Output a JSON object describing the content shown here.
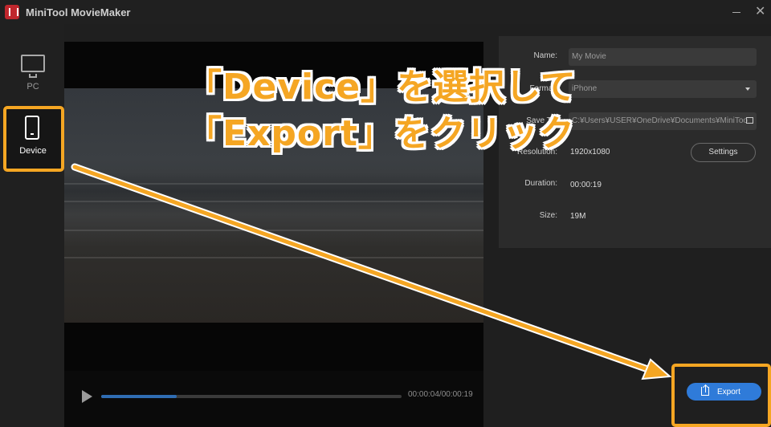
{
  "app": {
    "title": "MiniTool MovieMaker"
  },
  "sidebar": {
    "items": [
      {
        "label": "PC",
        "icon": "monitor-icon"
      },
      {
        "label": "Device",
        "icon": "phone-icon",
        "selected": true
      }
    ]
  },
  "player": {
    "time": "00:00:04/00:00:19",
    "progress": 0.25
  },
  "settings": {
    "name_label": "Name:",
    "name_value": "My Movie",
    "format_label": "Format:",
    "format_value": "iPhone",
    "save_label": "Save To:",
    "save_value": "C:¥Users¥USER¥OneDrive¥Documents¥MiniToo",
    "resolution_label": "Resolution:",
    "resolution_value": "1920x1080",
    "settings_button": "Settings",
    "duration_label": "Duration:",
    "duration_value": "00:00:19",
    "size_label": "Size:",
    "size_value": "19M"
  },
  "export": {
    "label": "Export"
  },
  "annotation": {
    "line1": "「Device」を選択して",
    "line2": "「Export」をクリック"
  },
  "colors": {
    "accent": "#f5a623",
    "button_blue": "#2f7bd9"
  }
}
